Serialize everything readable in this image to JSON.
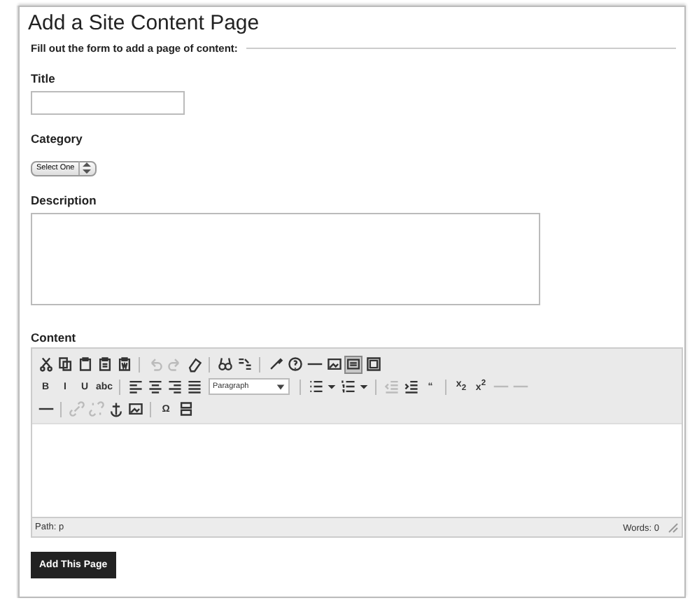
{
  "heading": "Add a Site Content Page",
  "legend": "Fill out the form to add a page of content:",
  "fields": [
    {
      "kind": "text",
      "label": "Title"
    },
    {
      "kind": "select",
      "label": "Category",
      "value": "Select One"
    },
    {
      "kind": "textarea",
      "label": "Description"
    }
  ],
  "editor": {
    "label": "Content",
    "toolbar": [
      [
        {
          "kind": "cut",
          "disabled": false
        },
        {
          "kind": "copy",
          "disabled": false
        },
        {
          "kind": "paste",
          "disabled": false
        },
        {
          "kind": "paste-text",
          "disabled": false
        },
        {
          "kind": "paste-word",
          "disabled": false
        },
        {
          "kind": "sep"
        },
        {
          "kind": "undo",
          "disabled": true
        },
        {
          "kind": "redo",
          "disabled": true
        },
        {
          "kind": "eraser",
          "disabled": false
        },
        {
          "kind": "sep"
        },
        {
          "kind": "find",
          "disabled": false
        },
        {
          "kind": "replace",
          "disabled": false
        },
        {
          "kind": "sep"
        },
        {
          "kind": "brush",
          "disabled": false
        },
        {
          "kind": "help",
          "disabled": false
        },
        {
          "kind": "rule",
          "disabled": false
        },
        {
          "kind": "image",
          "disabled": false
        },
        {
          "kind": "html",
          "disabled": false,
          "selected": true
        },
        {
          "kind": "fullscreen",
          "disabled": false
        }
      ],
      [
        {
          "kind": "text",
          "text": "B",
          "disabled": false
        },
        {
          "kind": "text",
          "text": "I",
          "disabled": false
        },
        {
          "kind": "text",
          "text": "U",
          "disabled": false
        },
        {
          "kind": "text",
          "text": "abc",
          "disabled": false
        },
        {
          "kind": "sep"
        },
        {
          "kind": "align-left",
          "disabled": false
        },
        {
          "kind": "align-center",
          "disabled": false
        },
        {
          "kind": "align-right",
          "disabled": false
        },
        {
          "kind": "justify",
          "disabled": false
        },
        {
          "kind": "select",
          "text": "Paragraph"
        },
        {
          "kind": "sep"
        },
        {
          "kind": "bullet-list",
          "disabled": false
        },
        {
          "kind": "caret",
          "disabled": false
        },
        {
          "kind": "numbered-list",
          "disabled": false
        },
        {
          "kind": "caret",
          "disabled": false
        },
        {
          "kind": "sep"
        },
        {
          "kind": "outdent",
          "disabled": true
        },
        {
          "kind": "indent",
          "disabled": false
        },
        {
          "kind": "text",
          "text": "“",
          "disabled": false
        },
        {
          "kind": "sep"
        },
        {
          "kind": "text",
          "text": "x$_{2}$",
          "disabled": false
        },
        {
          "kind": "text",
          "text": "x$^{2}$",
          "disabled": false
        },
        {
          "kind": "rule",
          "disabled": true
        },
        {
          "kind": "rule",
          "disabled": true
        }
      ],
      [
        {
          "kind": "rule",
          "disabled": false
        },
        {
          "kind": "sep"
        },
        {
          "kind": "link",
          "disabled": true
        },
        {
          "kind": "unlink",
          "disabled": true
        },
        {
          "kind": "anchor",
          "disabled": false
        },
        {
          "kind": "image",
          "disabled": false
        },
        {
          "kind": "sep"
        },
        {
          "kind": "text",
          "text": "Ω",
          "disabled": false
        },
        {
          "kind": "page-break",
          "disabled": false
        }
      ]
    ],
    "path": "Path: p",
    "words": "Words: 0"
  },
  "submit": "Add This Page"
}
